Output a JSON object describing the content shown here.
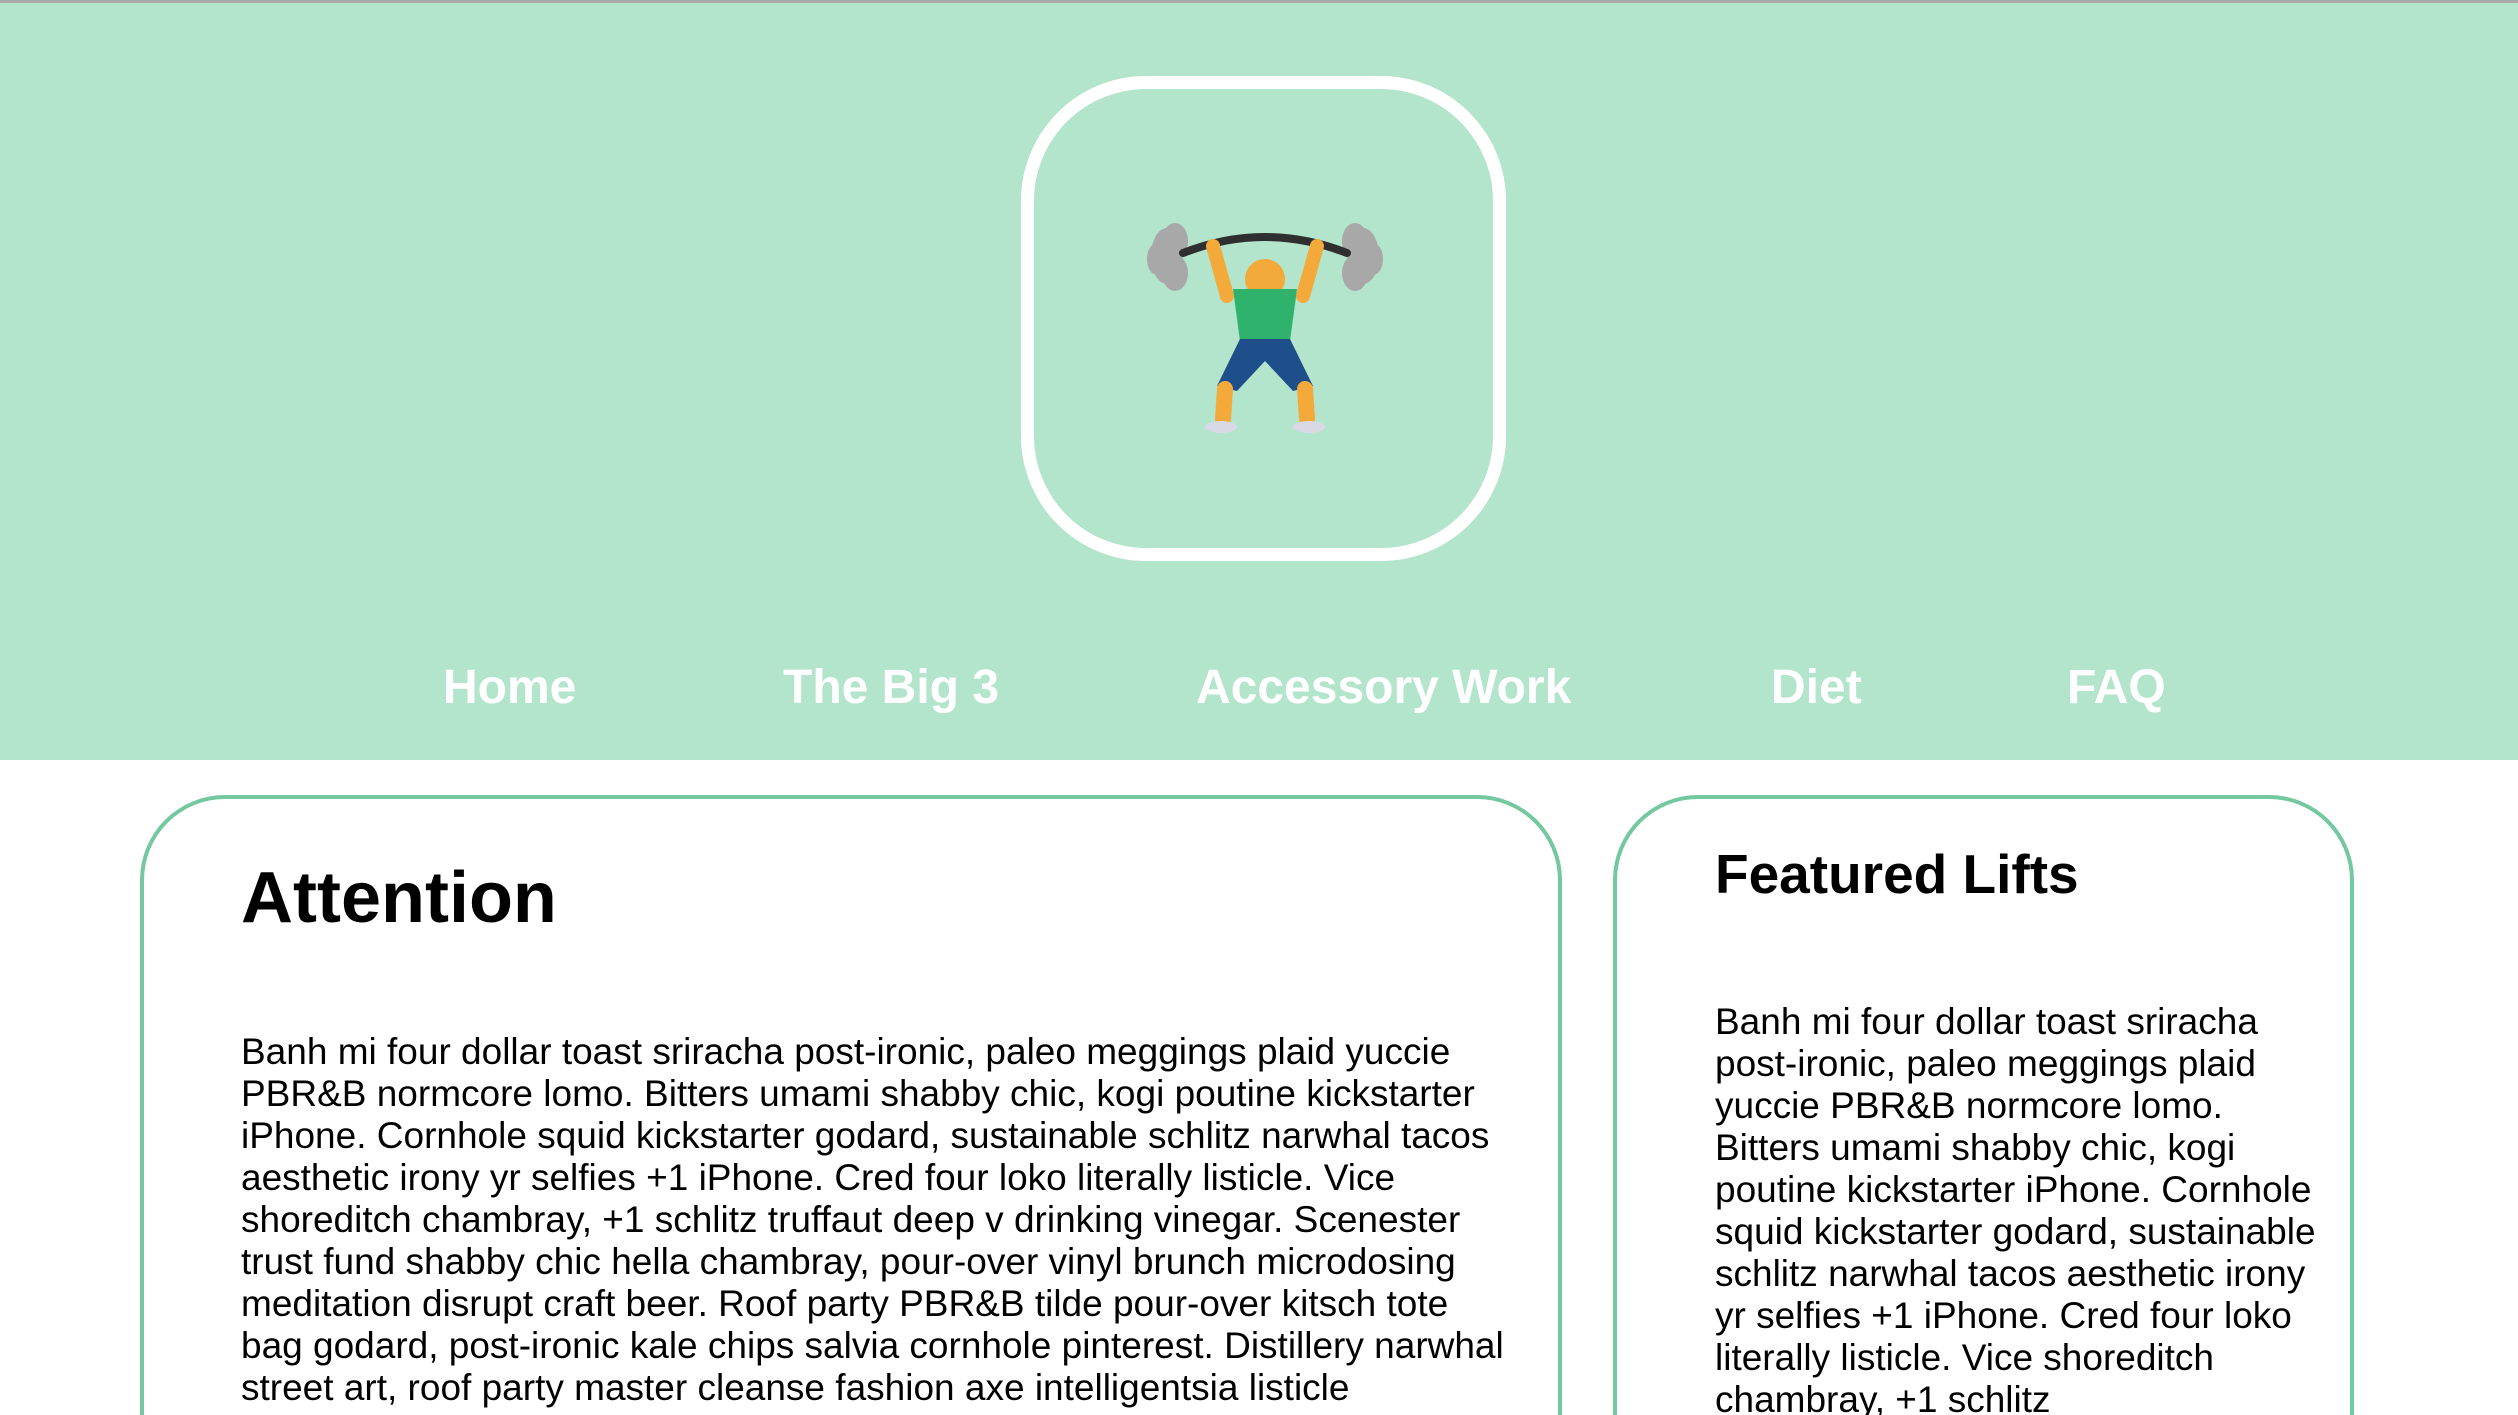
{
  "header": {
    "background_color": "#b3e4cc",
    "logo": {
      "icon": "weightlifter-icon"
    }
  },
  "nav": {
    "items": [
      {
        "label": "Home"
      },
      {
        "label": "The Big 3"
      },
      {
        "label": "Accessory Work"
      },
      {
        "label": "Diet"
      },
      {
        "label": "FAQ"
      }
    ]
  },
  "main_card": {
    "title": "Attention",
    "body": "Banh mi four dollar toast sriracha post-ironic, paleo meggings plaid yuccie PBR&B normcore lomo. Bitters umami shabby chic, kogi poutine kickstarter iPhone. Cornhole squid kickstarter godard, sustainable schlitz narwhal tacos aesthetic irony yr selfies +1 iPhone. Cred four loko literally listicle. Vice shoreditch chambray, +1 schlitz truffaut deep v drinking vinegar. Scenester trust fund shabby chic hella chambray, pour-over vinyl brunch microdosing meditation disrupt craft beer. Roof party PBR&B tilde pour-over kitsch tote bag godard, post-ironic kale chips salvia cornhole pinterest. Distillery narwhal street art, roof party master cleanse fashion axe intelligentsia listicle"
  },
  "side_card": {
    "title": "Featured Lifts",
    "body": "Banh mi four dollar toast sriracha post-ironic, paleo meggings plaid yuccie PBR&B normcore lomo. Bitters umami shabby chic, kogi poutine kickstarter iPhone. Cornhole squid kickstarter godard, sustainable schlitz narwhal tacos aesthetic irony yr selfies +1 iPhone. Cred four loko literally listicle. Vice shoreditch chambray, +1 schlitz"
  },
  "colors": {
    "accent_border": "#74c89f",
    "nav_text": "#ffffff"
  }
}
